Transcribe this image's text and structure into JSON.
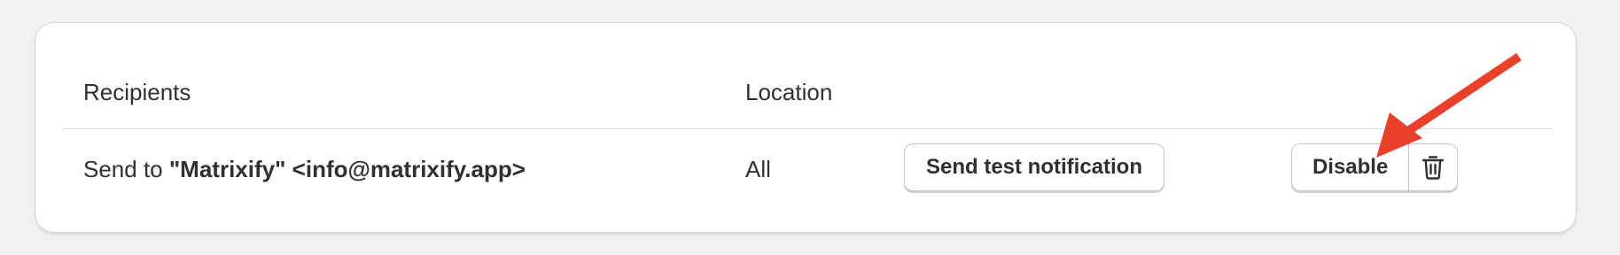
{
  "table": {
    "headers": {
      "recipients": "Recipients",
      "location": "Location"
    },
    "rows": [
      {
        "recipient_prefix": "Send to ",
        "recipient_bold": "\"Matrixify\" <info@matrixify.app>",
        "location": "All",
        "test_button_label": "Send test notification",
        "disable_button_label": "Disable",
        "delete_icon": "trash-icon"
      }
    ]
  },
  "annotation": {
    "arrow_color": "#e8402a"
  }
}
